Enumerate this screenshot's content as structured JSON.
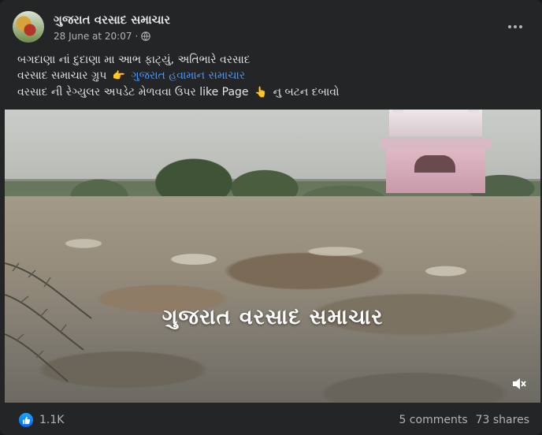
{
  "post": {
    "page_name": "ગુજરાત વરસાદ સમાચાર",
    "timestamp": "28 June at 20:07",
    "separator": "·",
    "text": {
      "line1": "બગદાણા નાં દુદાણા મા આભ ફાટ્યું, અતિભારે વરસાદ",
      "line2_prefix": "વરસાદ સમાચાર ગ્રુપ",
      "line2_emoji": "👉",
      "line2_link": "ગુજરાત હવામાન સમાચાર",
      "line3_prefix": "વરસાદ ની રેગ્યુલર અપડેટ મેળવવા ઉપર like Page",
      "line3_emoji": "👆",
      "line3_suffix": "નુ બટન દબાવો"
    },
    "video": {
      "watermark": "ગુજરાત વરસાદ સમાચાર"
    }
  },
  "footer": {
    "reaction_icon": "like-icon",
    "reaction_count": "1.1K",
    "comments": "5 comments",
    "shares": "73 shares"
  },
  "colors": {
    "card_bg": "#242526",
    "text_primary": "#e4e6eb",
    "text_secondary": "#b0b3b8",
    "link": "#4599ff",
    "like_blue": "#0866ff"
  }
}
